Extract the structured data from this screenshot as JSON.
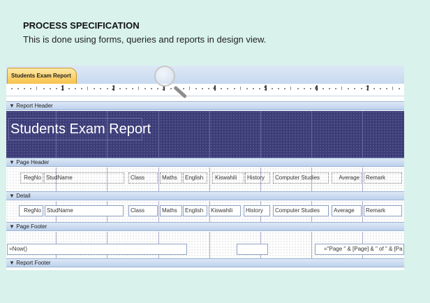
{
  "slide": {
    "heading": "PROCESS SPECIFICATION",
    "subheading": "This is done using forms, queries and reports in design view."
  },
  "designer": {
    "tab_label": "Students Exam Report",
    "ruler_numbers": [
      "1",
      "2",
      "3",
      "4",
      "5",
      "6",
      "7"
    ],
    "sections": {
      "report_header": "Report Header",
      "page_header": "Page Header",
      "detail": "Detail",
      "page_footer": "Page Footer",
      "report_footer": "Report Footer"
    },
    "report_title": "Students Exam Report",
    "page_header_labels": [
      "RegNo",
      "StudName",
      "Class",
      "Maths",
      "English",
      "Kiswahili",
      "History",
      "Computer Studies",
      "Average",
      "Remark"
    ],
    "detail_fields": [
      "RegNo",
      "StudName",
      "Class",
      "Maths",
      "English",
      "Kiswahili",
      "History",
      "Computer Studies",
      "Average",
      "Remark"
    ],
    "page_footer": {
      "left_expression": "=Now()",
      "right_expression": "=\"Page \" & [Page] & \" of \" & [Pa"
    }
  },
  "colors": {
    "background": "#d9f2ec",
    "header_band": "#3c3c78",
    "tab": "#f7c24a"
  },
  "icons": {
    "section_icon": "section-arrow-icon",
    "zoom": "magnifier-icon"
  }
}
